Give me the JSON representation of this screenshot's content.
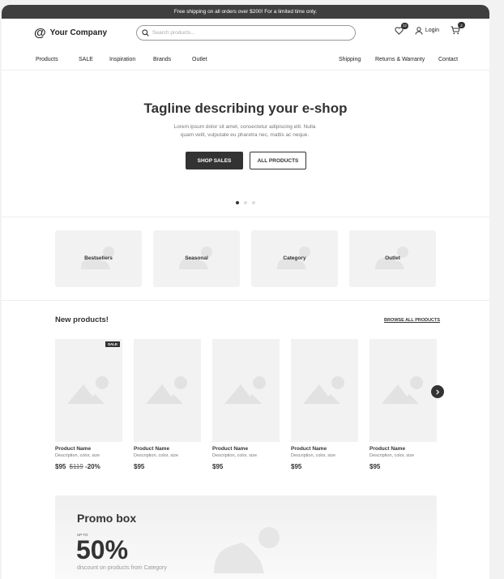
{
  "topbar": {
    "text": "Free shipping on all orders over $200! For a limited time only."
  },
  "header": {
    "logo_mark": "@",
    "company": "Your Company",
    "search_placeholder": "Search products...",
    "wishlist_count": "12",
    "login_label": "Login",
    "cart_count": "2"
  },
  "nav": {
    "left": [
      "Products",
      "SALE",
      "Inspiration",
      "Brands",
      "Outlet"
    ],
    "right": [
      "Shipping",
      "Returns & Warranty",
      "Contact"
    ]
  },
  "hero": {
    "title": "Tagline describing your e-shop",
    "subtitle": "Lorem ipsum dolor sit amet, consectetur adipiscing elit. Nulla quam velit, vulputate eu pharetra nec, mattis ac neque.",
    "primary_button": "SHOP SALES",
    "secondary_button": "ALL PRODUCTS",
    "slides": 3,
    "active_slide": 1
  },
  "categories": [
    "Bestsellers",
    "Seasonal",
    "Category",
    "Outlet"
  ],
  "new_products": {
    "title": "New products!",
    "browse_link": "BROWSE ALL PRODUCTS",
    "items": [
      {
        "name": "Product Name",
        "desc": "Description, color, size",
        "price": "$95",
        "old_price": "$119",
        "discount": "-20%",
        "badge": "SALE"
      },
      {
        "name": "Product Name",
        "desc": "Description, color, size",
        "price": "$95"
      },
      {
        "name": "Product Name",
        "desc": "Description, color, size",
        "price": "$95"
      },
      {
        "name": "Product Name",
        "desc": "Description, color, size",
        "price": "$95"
      },
      {
        "name": "Product Name",
        "desc": "Description, color, size",
        "price": "$95"
      }
    ]
  },
  "promo": {
    "title": "Promo box",
    "up_to": "UP TO",
    "percent": "50%",
    "discount_text": "discount on products from Category"
  }
}
